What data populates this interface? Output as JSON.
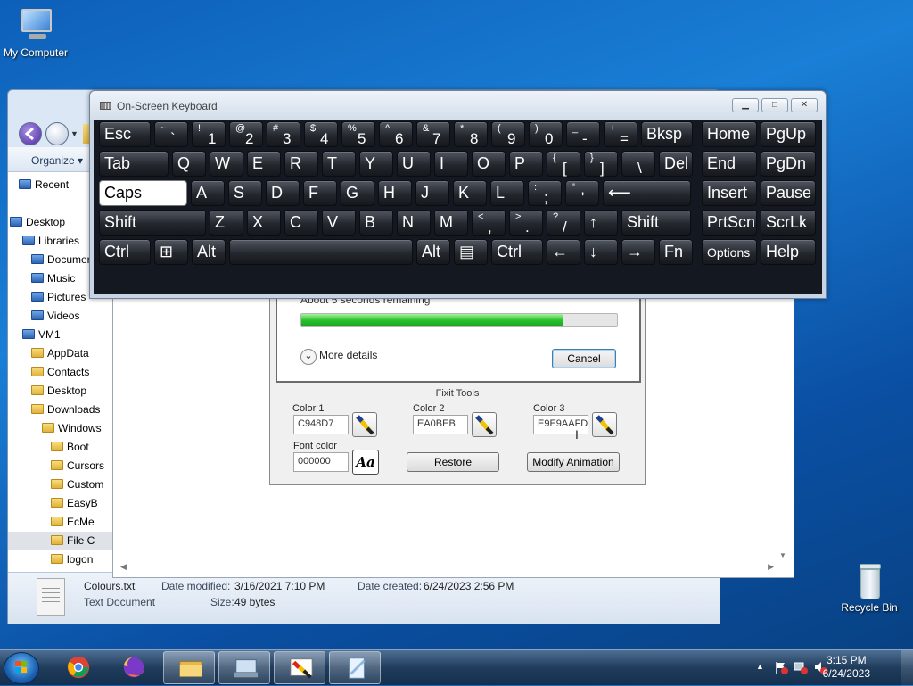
{
  "desktop": {
    "my_computer": "My Computer",
    "recycle_bin": "Recycle Bin"
  },
  "explorer": {
    "organize": "Organize ▾",
    "tree": [
      {
        "label": "Recent",
        "icon": "recent-places-icon"
      },
      {
        "label": "Desktop",
        "icon": "desktop-icon"
      },
      {
        "label": "Libraries",
        "icon": "libraries-icon"
      },
      {
        "label": "Documents",
        "icon": "documents-icon"
      },
      {
        "label": "Music",
        "icon": "music-icon"
      },
      {
        "label": "Pictures",
        "icon": "pictures-icon"
      },
      {
        "label": "Videos",
        "icon": "videos-icon"
      },
      {
        "label": "VM1",
        "icon": "user-folder-icon"
      },
      {
        "label": "AppData",
        "icon": "folder-icon"
      },
      {
        "label": "Contacts",
        "icon": "folder-icon"
      },
      {
        "label": "Desktop",
        "icon": "folder-icon"
      },
      {
        "label": "Downloads",
        "icon": "folder-icon"
      },
      {
        "label": "Windows",
        "icon": "folder-icon"
      },
      {
        "label": "Boot",
        "icon": "folder-icon"
      },
      {
        "label": "Cursors",
        "icon": "folder-icon"
      },
      {
        "label": "Custom",
        "icon": "folder-icon"
      },
      {
        "label": "EasyB",
        "icon": "folder-icon"
      },
      {
        "label": "EcMe",
        "icon": "folder-icon"
      },
      {
        "label": "File C",
        "icon": "folder-icon"
      },
      {
        "label": "logon",
        "icon": "folder-icon"
      }
    ],
    "details": {
      "file_name": "Colours.txt",
      "file_type": "Text Document",
      "date_modified_label": "Date modified:",
      "date_modified": "3/16/2021 7:10 PM",
      "date_created_label": "Date created:",
      "date_created": "6/24/2023 2:56 PM",
      "size_label": "Size:",
      "size": "49 bytes"
    }
  },
  "copy_dialog": {
    "status": "About 5 seconds remaining",
    "progress_percent": 83,
    "more_details": "More details",
    "cancel": "Cancel"
  },
  "fixit": {
    "title": "Fixit Tools",
    "color1_label": "Color 1",
    "color1_value": "C948D7",
    "color2_label": "Color 2",
    "color2_value": "EA0BEB",
    "color3_label": "Color 3",
    "color3_value": "E9E9AAFD",
    "font_color_label": "Font color",
    "font_color_value": "000000",
    "font_button": "Aa",
    "restore": "Restore",
    "modify_animation": "Modify Animation"
  },
  "osk": {
    "title": "On-Screen Keyboard",
    "rows": [
      [
        {
          "m": "Esc"
        },
        {
          "s": "~",
          "b": "`"
        },
        {
          "s": "!",
          "b": "1"
        },
        {
          "s": "@",
          "b": "2"
        },
        {
          "s": "#",
          "b": "3"
        },
        {
          "s": "$",
          "b": "4"
        },
        {
          "s": "%",
          "b": "5"
        },
        {
          "s": "^",
          "b": "6"
        },
        {
          "s": "&",
          "b": "7"
        },
        {
          "s": "*",
          "b": "8"
        },
        {
          "s": "(",
          "b": "9"
        },
        {
          "s": ")",
          "b": "0"
        },
        {
          "s": "_",
          "b": "-"
        },
        {
          "s": "+",
          "b": "="
        },
        {
          "m": "Bksp"
        },
        {
          "m": "Home"
        },
        {
          "m": "PgUp"
        }
      ],
      [
        {
          "m": "Tab"
        },
        {
          "m": "Q"
        },
        {
          "m": "W"
        },
        {
          "m": "E"
        },
        {
          "m": "R"
        },
        {
          "m": "T"
        },
        {
          "m": "Y"
        },
        {
          "m": "U"
        },
        {
          "m": "I"
        },
        {
          "m": "O"
        },
        {
          "m": "P"
        },
        {
          "s": "{",
          "b": "["
        },
        {
          "s": "}",
          "b": "]"
        },
        {
          "s": "|",
          "b": "\\"
        },
        {
          "m": "Del"
        },
        {
          "m": "End"
        },
        {
          "m": "PgDn"
        }
      ],
      [
        {
          "m": "Caps"
        },
        {
          "m": "A"
        },
        {
          "m": "S"
        },
        {
          "m": "D"
        },
        {
          "m": "F"
        },
        {
          "m": "G"
        },
        {
          "m": "H"
        },
        {
          "m": "J"
        },
        {
          "m": "K"
        },
        {
          "m": "L"
        },
        {
          "s": ":",
          "b": ";"
        },
        {
          "s": "\"",
          "b": "'"
        },
        {
          "m": "⟵"
        },
        {
          "m": "Insert"
        },
        {
          "m": "Pause"
        }
      ],
      [
        {
          "m": "Shift"
        },
        {
          "m": "Z"
        },
        {
          "m": "X"
        },
        {
          "m": "C"
        },
        {
          "m": "V"
        },
        {
          "m": "B"
        },
        {
          "m": "N"
        },
        {
          "m": "M"
        },
        {
          "s": "<",
          "b": ","
        },
        {
          "s": ">",
          "b": "."
        },
        {
          "s": "?",
          "b": "/"
        },
        {
          "m": "↑"
        },
        {
          "m": "Shift"
        },
        {
          "m": "PrtScn"
        },
        {
          "m": "ScrLk"
        }
      ],
      [
        {
          "m": "Ctrl"
        },
        {
          "m": "⊞"
        },
        {
          "m": "Alt"
        },
        {
          "m": ""
        },
        {
          "m": "Alt"
        },
        {
          "m": "▤"
        },
        {
          "m": "Ctrl"
        },
        {
          "m": "←"
        },
        {
          "m": "↓"
        },
        {
          "m": "→"
        },
        {
          "m": "Fn"
        },
        {
          "m": "Options"
        },
        {
          "m": "Help"
        }
      ]
    ]
  },
  "taskbar": {
    "time": "3:15 PM",
    "date": "6/24/2023"
  }
}
